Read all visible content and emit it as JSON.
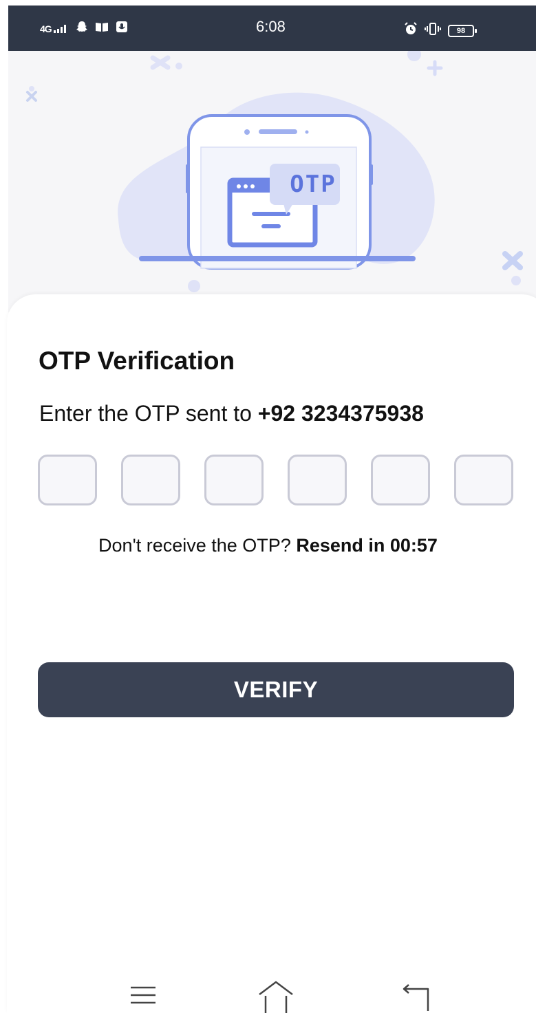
{
  "status_bar": {
    "network": "4G",
    "time": "6:08",
    "battery": "98",
    "icons": [
      "signal-icon",
      "snapchat-icon",
      "book-icon",
      "mic-app-icon",
      "alarm-icon",
      "vibrate-icon",
      "battery-icon"
    ]
  },
  "illustration": {
    "badge_text": "OTP"
  },
  "screen": {
    "title": "OTP Verification",
    "prompt": "Enter the OTP sent to",
    "phone": "+92 3234375938",
    "otp_digits": [
      "",
      "",
      "",
      "",
      "",
      ""
    ],
    "resend_question": "Don't receive the OTP?",
    "resend_timer": "Resend in 00:57",
    "verify_label": "VERIFY"
  },
  "nav": {
    "icons": [
      "menu-icon",
      "home-icon",
      "back-icon"
    ]
  },
  "colors": {
    "status_bar": "#2f3747",
    "button": "#3a4254",
    "accent": "#5b78e6",
    "otp_border": "#c9cad6"
  }
}
